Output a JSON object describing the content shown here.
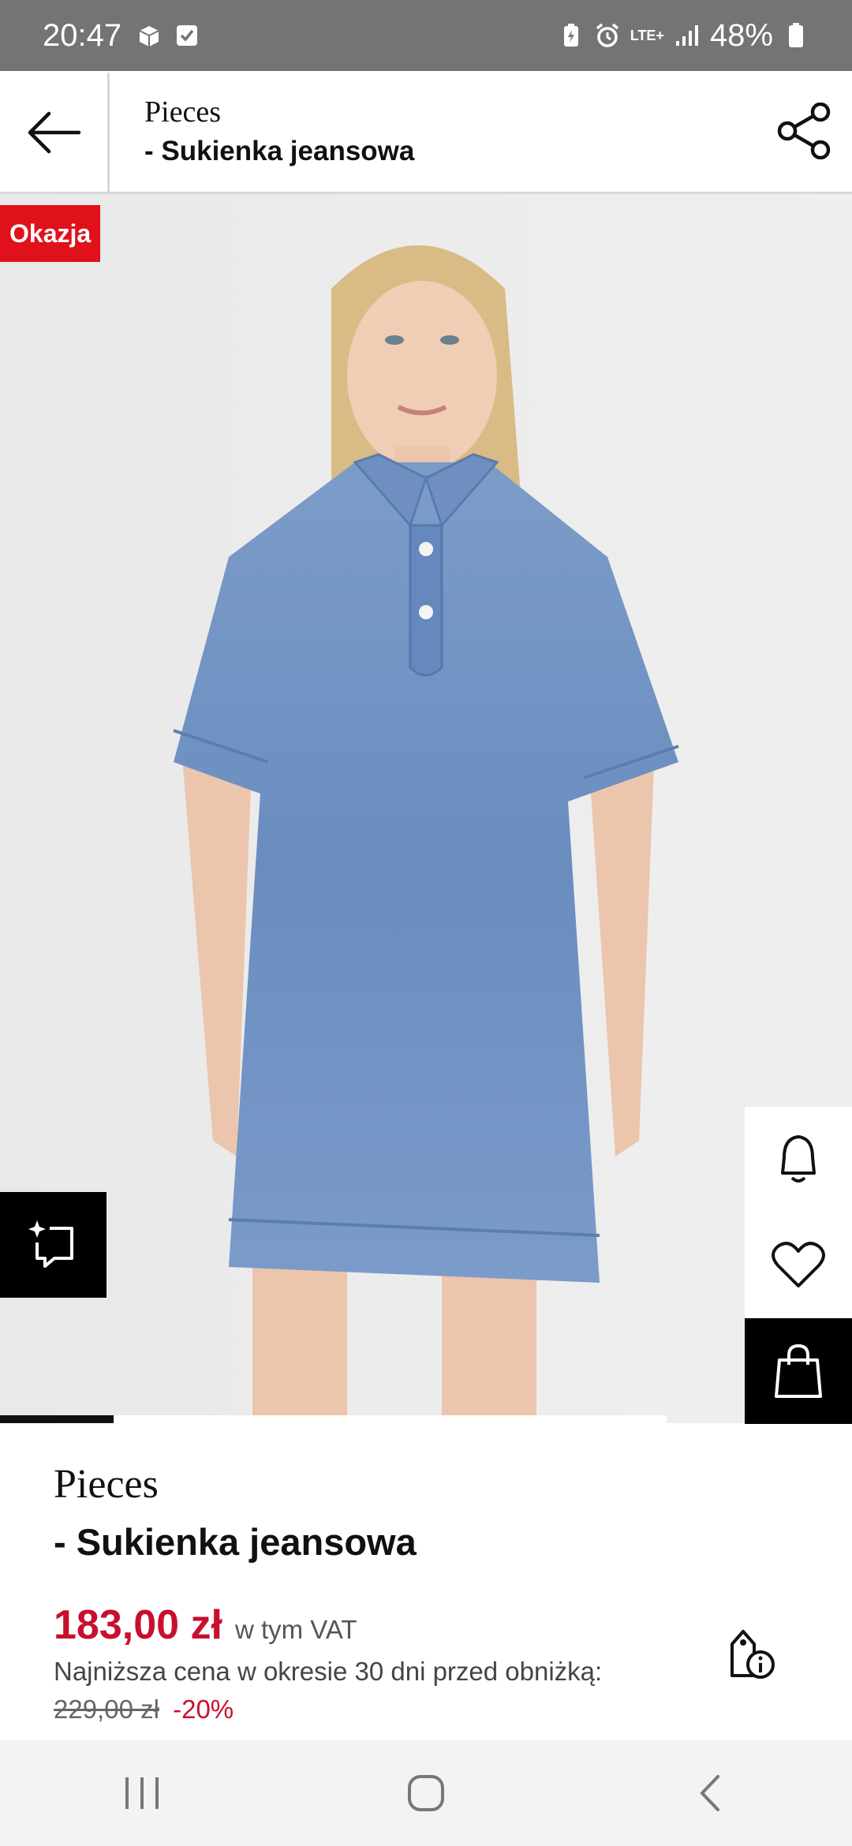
{
  "status_bar": {
    "time": "20:47",
    "network": "LTE+",
    "battery": "48%",
    "icons": [
      "package-icon",
      "checkbox-icon",
      "battery-saver-icon",
      "alarm-icon",
      "signal-icon",
      "battery-icon"
    ]
  },
  "header": {
    "brand": "Pieces",
    "product_name": "- Sukienka jeansowa",
    "back_icon": "arrow-left-icon",
    "share_icon": "share-icon"
  },
  "image": {
    "badge": "Okazja",
    "slide_progress": 0.17
  },
  "side_actions": [
    "bell-icon",
    "heart-icon",
    "shopping-bag-icon"
  ],
  "ai_button_icon": "ai-sparkle-icon",
  "product": {
    "brand": "Pieces",
    "name": "- Sukienka jeansowa",
    "price": "183,00 zł",
    "vat": "w tym VAT",
    "lowest_price_label": "Najniższa cena w okresie 30 dni przed obniżką:",
    "old_price": "229,00 zł",
    "discount": "-20%"
  },
  "colors": {
    "accent_red": "#c8102e",
    "badge_red": "#e0111b",
    "denim": "#6f93c4"
  },
  "nav_bar": [
    "recents-icon",
    "home-icon",
    "back-icon"
  ]
}
